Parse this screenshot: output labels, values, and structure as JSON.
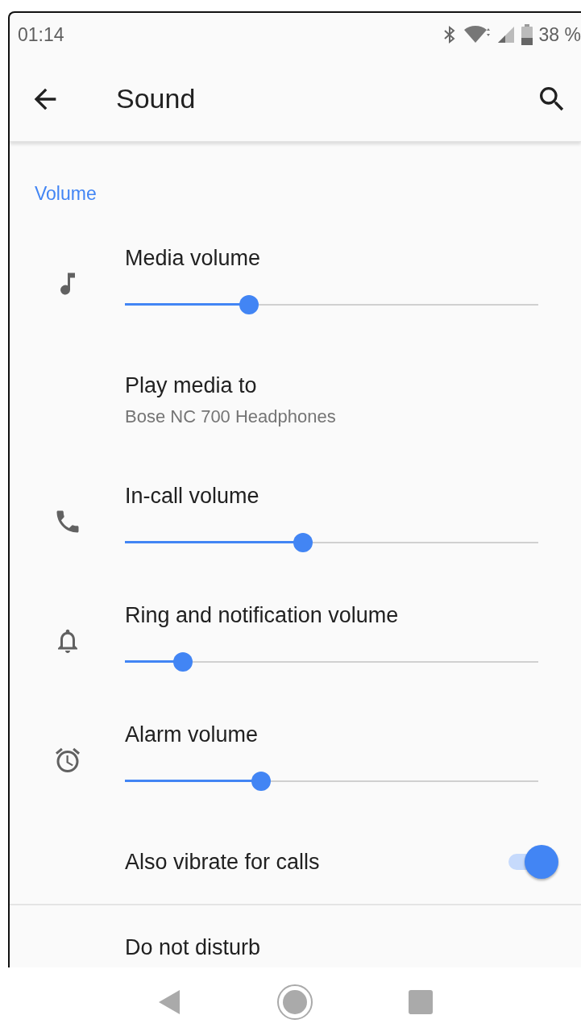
{
  "status_bar": {
    "time": "01:14",
    "battery": "38 %"
  },
  "app_bar": {
    "title": "Sound"
  },
  "section": {
    "title": "Volume"
  },
  "items": [
    {
      "kind": "slider",
      "title": "Media volume",
      "level": 0.3
    },
    {
      "kind": "text",
      "title": "Play media to",
      "subtitle": "Bose NC 700 Headphones"
    },
    {
      "kind": "slider",
      "title": "In-call volume",
      "level": 0.43
    },
    {
      "kind": "slider",
      "title": "Ring and notification volume",
      "level": 0.14
    },
    {
      "kind": "slider",
      "title": "Alarm volume",
      "level": 0.33
    },
    {
      "kind": "toggle",
      "title": "Also vibrate for calls",
      "on": true
    }
  ],
  "next_section": {
    "title": "Do not disturb"
  }
}
